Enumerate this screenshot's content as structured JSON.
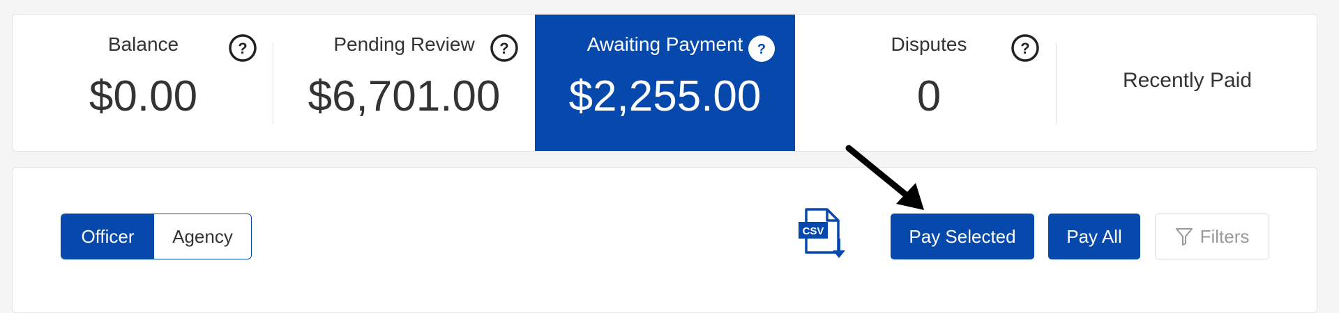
{
  "stats": {
    "balance": {
      "label": "Balance",
      "value": "$0.00"
    },
    "pending_review": {
      "label": "Pending Review",
      "value": "$6,701.00"
    },
    "awaiting_payment": {
      "label": "Awaiting Payment",
      "value": "$2,255.00"
    },
    "disputes": {
      "label": "Disputes",
      "value": "0"
    },
    "recently_paid": {
      "label": "Recently Paid"
    },
    "help_glyph": "?"
  },
  "toolbar": {
    "toggle": {
      "officer": "Officer",
      "agency": "Agency",
      "selected": "Officer"
    },
    "csv_label": "CSV",
    "pay_selected": "Pay Selected",
    "pay_all": "Pay All",
    "filters": "Filters"
  },
  "colors": {
    "accent": "#0748ad",
    "text": "#333333",
    "muted": "#9a9a9a",
    "background": "#f5f5f5"
  },
  "icons": {
    "help": "question-circle-icon",
    "csv": "csv-download-icon",
    "filter": "funnel-icon",
    "annotation": "arrow-annotation"
  }
}
